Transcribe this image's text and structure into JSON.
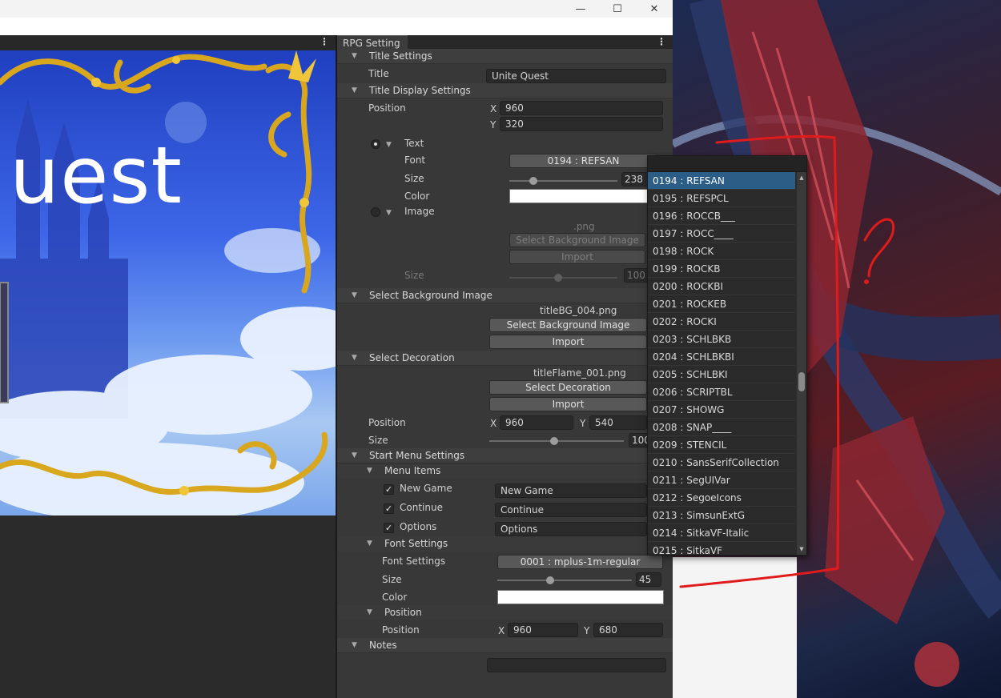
{
  "window": {
    "minimize_icon": "minimize-icon",
    "maximize_icon": "maximize-icon",
    "close_icon": "close-icon"
  },
  "game_view": {
    "title_fragment": "uest"
  },
  "inspector": {
    "tab_label": "RPG Setting",
    "title_settings": {
      "header": "Title Settings",
      "title_label": "Title",
      "title_value": "Unite Quest"
    },
    "title_display": {
      "header": "Title Display Settings",
      "position_label": "Position",
      "x_label": "X",
      "y_label": "Y",
      "x_value": "960",
      "y_value": "320",
      "text_label": "Text",
      "font_label": "Font",
      "font_value": "0194 : REFSAN",
      "size_label": "Size",
      "size_value": "238",
      "size_fraction": 0.22,
      "color_label": "Color",
      "color_value": "#ffffff",
      "image_label": "Image",
      "image_file": ".png",
      "select_bg_button": "Select Background Image",
      "import_button": "Import",
      "image_size_label": "Size",
      "image_size_value": "100",
      "image_size_fraction": 0.45
    },
    "background": {
      "header": "Select Background Image",
      "file": "titleBG_004.png",
      "select_button": "Select Background Image",
      "import_button": "Import"
    },
    "decoration": {
      "header": "Select Decoration",
      "file": "titleFlame_001.png",
      "select_button": "Select Decoration",
      "import_button": "Import",
      "position_label": "Position",
      "x_label": "X",
      "y_label": "Y",
      "x_value": "960",
      "y_value": "540",
      "size_label": "Size",
      "size_value": "100",
      "size_fraction": 0.48
    },
    "start_menu": {
      "header": "Start Menu Settings",
      "menu_items_label": "Menu Items",
      "items": [
        {
          "label": "New Game",
          "value": "New Game",
          "checked": true
        },
        {
          "label": "Continue",
          "value": "Continue",
          "checked": true
        },
        {
          "label": "Options",
          "value": "Options",
          "checked": true
        }
      ],
      "font_settings_header": "Font Settings",
      "font_label": "Font Settings",
      "font_value": "0001 : mplus-1m-regular",
      "size_label": "Size",
      "size_value": "45",
      "size_fraction": 0.39,
      "color_label": "Color",
      "color_value": "#ffffff",
      "position_header": "Position",
      "position_label": "Position",
      "x_label": "X",
      "y_label": "Y",
      "x_value": "960",
      "y_value": "680"
    },
    "notes": {
      "header": "Notes",
      "value": ""
    }
  },
  "font_dropdown": {
    "selected": "0194 : REFSAN",
    "options": [
      "0194 : REFSAN",
      "0195 : REFSPCL",
      "0196 : ROCCB___",
      "0197 : ROCC____",
      "0198 : ROCK",
      "0199 : ROCKB",
      "0200 : ROCKBI",
      "0201 : ROCKEB",
      "0202 : ROCKI",
      "0203 : SCHLBKB",
      "0204 : SCHLBKBI",
      "0205 : SCHLBKI",
      "0206 : SCRIPTBL",
      "0207 : SHOWG",
      "0208 : SNAP____",
      "0209 : STENCIL",
      "0210 : SansSerifCollection",
      "0211 : SegUIVar",
      "0212 : SegoeIcons",
      "0213 : SimsunExtG",
      "0214 : SitkaVF-Italic",
      "0215 : SitkaVF"
    ]
  }
}
